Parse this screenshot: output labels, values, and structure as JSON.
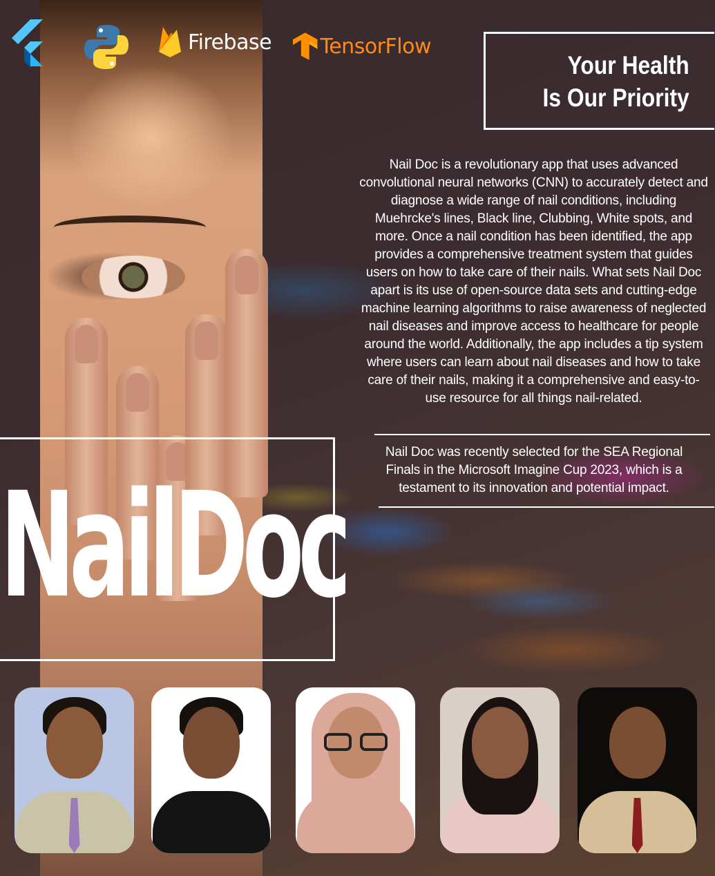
{
  "logos": {
    "flutter_icon": "flutter-logo",
    "python_icon": "python-logo",
    "firebase_label": "Firebase",
    "tensorflow_label": "TensorFlow"
  },
  "tagline": {
    "line1": "Your Health",
    "line2": "Is Our Priority"
  },
  "description": "Nail Doc is a revolutionary app that uses advanced convolutional neural networks (CNN) to accurately detect and diagnose a wide range of nail conditions, including Muehrcke's lines, Black line, Clubbing, White spots, and more. Once a nail condition has been identified, the app provides a comprehensive treatment system that guides users on how to take care of their nails. What sets Nail Doc apart is its use of open-source data sets and cutting-edge machine learning algorithms to raise awareness of neglected nail diseases and improve access to healthcare for people around the world. Additionally, the app includes a tip system where users can learn about nail diseases and how to take care of their nails, making it a comprehensive and easy-to-use resource for all things nail-related.",
  "award": "Nail Doc was recently selected for the SEA Regional Finals in the Microsoft Imagine Cup 2023, which is a testament to its innovation and potential impact.",
  "title": "NailDoc",
  "colors": {
    "background": "#3b2c30",
    "text": "#ffffff",
    "tensorflow_orange": "#ff8a1a",
    "firebase_yellow": "#ffca28"
  },
  "team_photos": [
    {
      "name": "team-member-photo-1",
      "bg": "#b9c7e4",
      "skin": "#8a5a3a",
      "hair": "#1a120c",
      "outfit": "#c9c4a8",
      "accent": "#9d7ab8"
    },
    {
      "name": "team-member-photo-2",
      "bg": "#ffffff",
      "skin": "#7a4e34",
      "hair": "#15100c",
      "outfit": "#141414",
      "accent": "#141414"
    },
    {
      "name": "team-member-photo-3",
      "bg": "#ffffff",
      "skin": "#c28a6c",
      "hair": "#dba89a",
      "outfit": "#dba89a",
      "accent": "#dba89a"
    },
    {
      "name": "team-member-photo-4",
      "bg": "#d9cfc6",
      "skin": "#8a5a40",
      "hair": "#1a1210",
      "outfit": "#e8c8c2",
      "accent": "#1a1210"
    },
    {
      "name": "team-member-photo-5",
      "bg": "#0e0c0a",
      "skin": "#7a4e32",
      "hair": "#120c08",
      "outfit": "#d6bf98",
      "accent": "#8a1e1e"
    }
  ]
}
